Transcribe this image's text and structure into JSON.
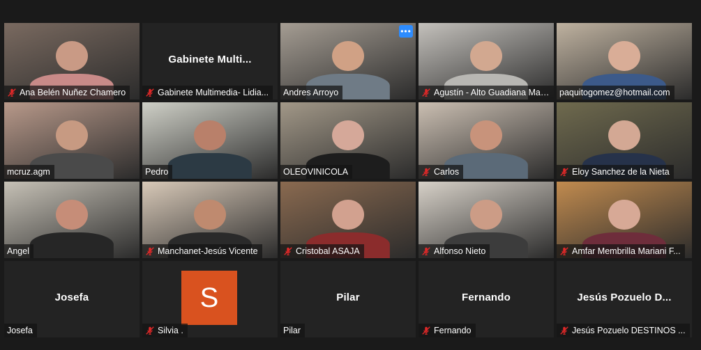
{
  "participants": [
    {
      "id": "p1",
      "display_name": "Ana Belén Nuñez Chamero",
      "muted": true,
      "video": true,
      "bg": "#7a6a60",
      "shirt": "#c98a88",
      "skin": "#c99a85"
    },
    {
      "id": "p2",
      "display_name": "Gabinete Multimedia- Lidia...",
      "big_name": "Gabinete  Multi...",
      "muted": true,
      "video": false
    },
    {
      "id": "p3",
      "display_name": "Andres Arroyo",
      "muted": false,
      "video": true,
      "bg": "#a59d93",
      "shirt": "#6f7b86",
      "skin": "#d0a185"
    },
    {
      "id": "p4",
      "display_name": "Agustín - Alto Guadiana Manc...",
      "muted": true,
      "video": true,
      "bg": "#c4c1bc",
      "shirt": "#b8b7b3",
      "skin": "#d2a890"
    },
    {
      "id": "p5",
      "display_name": "paquitogomez@hotmail.com",
      "muted": false,
      "video": true,
      "bg": "#bfb2a0",
      "shirt": "#3c5a8a",
      "skin": "#d9ad97"
    },
    {
      "id": "p6",
      "display_name": "mcruz.agm",
      "muted": false,
      "video": true,
      "bg": "#b8998a",
      "shirt": "#4a4a4a",
      "skin": "#c79a82"
    },
    {
      "id": "p7",
      "display_name": "Pedro",
      "muted": false,
      "video": true,
      "active": true,
      "bg": "#cfd0c7",
      "shirt": "#2c3a44",
      "skin": "#b9806a"
    },
    {
      "id": "p8",
      "display_name": "OLEOVINICOLA",
      "muted": false,
      "video": true,
      "bg": "#a29888",
      "shirt": "#1d1d1d",
      "skin": "#d5a899"
    },
    {
      "id": "p9",
      "display_name": "Carlos",
      "muted": true,
      "video": true,
      "bg": "#cbbfb2",
      "shirt": "#5b6a78",
      "skin": "#c8937b"
    },
    {
      "id": "p10",
      "display_name": "Eloy Sanchez de la Nieta",
      "muted": true,
      "video": true,
      "bg": "#6f6a4e",
      "shirt": "#26324a",
      "skin": "#d3a894"
    },
    {
      "id": "p11",
      "display_name": "Angel",
      "muted": false,
      "video": true,
      "bg": "#c6c1b6",
      "shirt": "#262626",
      "skin": "#c68d78"
    },
    {
      "id": "p12",
      "display_name": "Manchanet-Jesús Vicente",
      "muted": true,
      "video": true,
      "bg": "#d8c9b8",
      "shirt": "#2a2a2a",
      "skin": "#bf8a6f"
    },
    {
      "id": "p13",
      "display_name": "Cristobal ASAJA",
      "muted": true,
      "video": true,
      "bg": "#8a6a50",
      "shirt": "#8b2c2c",
      "skin": "#d2a18f"
    },
    {
      "id": "p14",
      "display_name": "Alfonso Nieto",
      "muted": true,
      "video": true,
      "bg": "#d7d1c8",
      "shirt": "#3c3c3c",
      "skin": "#cc9c86"
    },
    {
      "id": "p15",
      "display_name": "Amfar Membrilla Mariani F...",
      "muted": true,
      "video": true,
      "bg": "#c18b4f",
      "shirt": "#6e2d3b",
      "skin": "#d7a996"
    },
    {
      "id": "p16",
      "display_name": "Josefa",
      "big_name": "Josefa",
      "muted": false,
      "video": false
    },
    {
      "id": "p17",
      "display_name": "Silvia .",
      "avatar_letter": "S",
      "avatar_color": "#d9521f",
      "muted": true,
      "video": false
    },
    {
      "id": "p18",
      "display_name": "Pilar",
      "big_name": "Pilar",
      "muted": false,
      "video": false
    },
    {
      "id": "p19",
      "display_name": "Fernando",
      "big_name": "Fernando",
      "muted": true,
      "video": false
    },
    {
      "id": "p20",
      "display_name": "Jesús Pozuelo DESTINOS ...",
      "big_name": "Jesús  Pozuelo  D...",
      "muted": true,
      "video": false
    }
  ],
  "more_button_icon": "more-options-icon",
  "colors": {
    "active_outline": "#d8e27a",
    "mute_red": "#e02828",
    "more_blue": "#2d8cff"
  }
}
